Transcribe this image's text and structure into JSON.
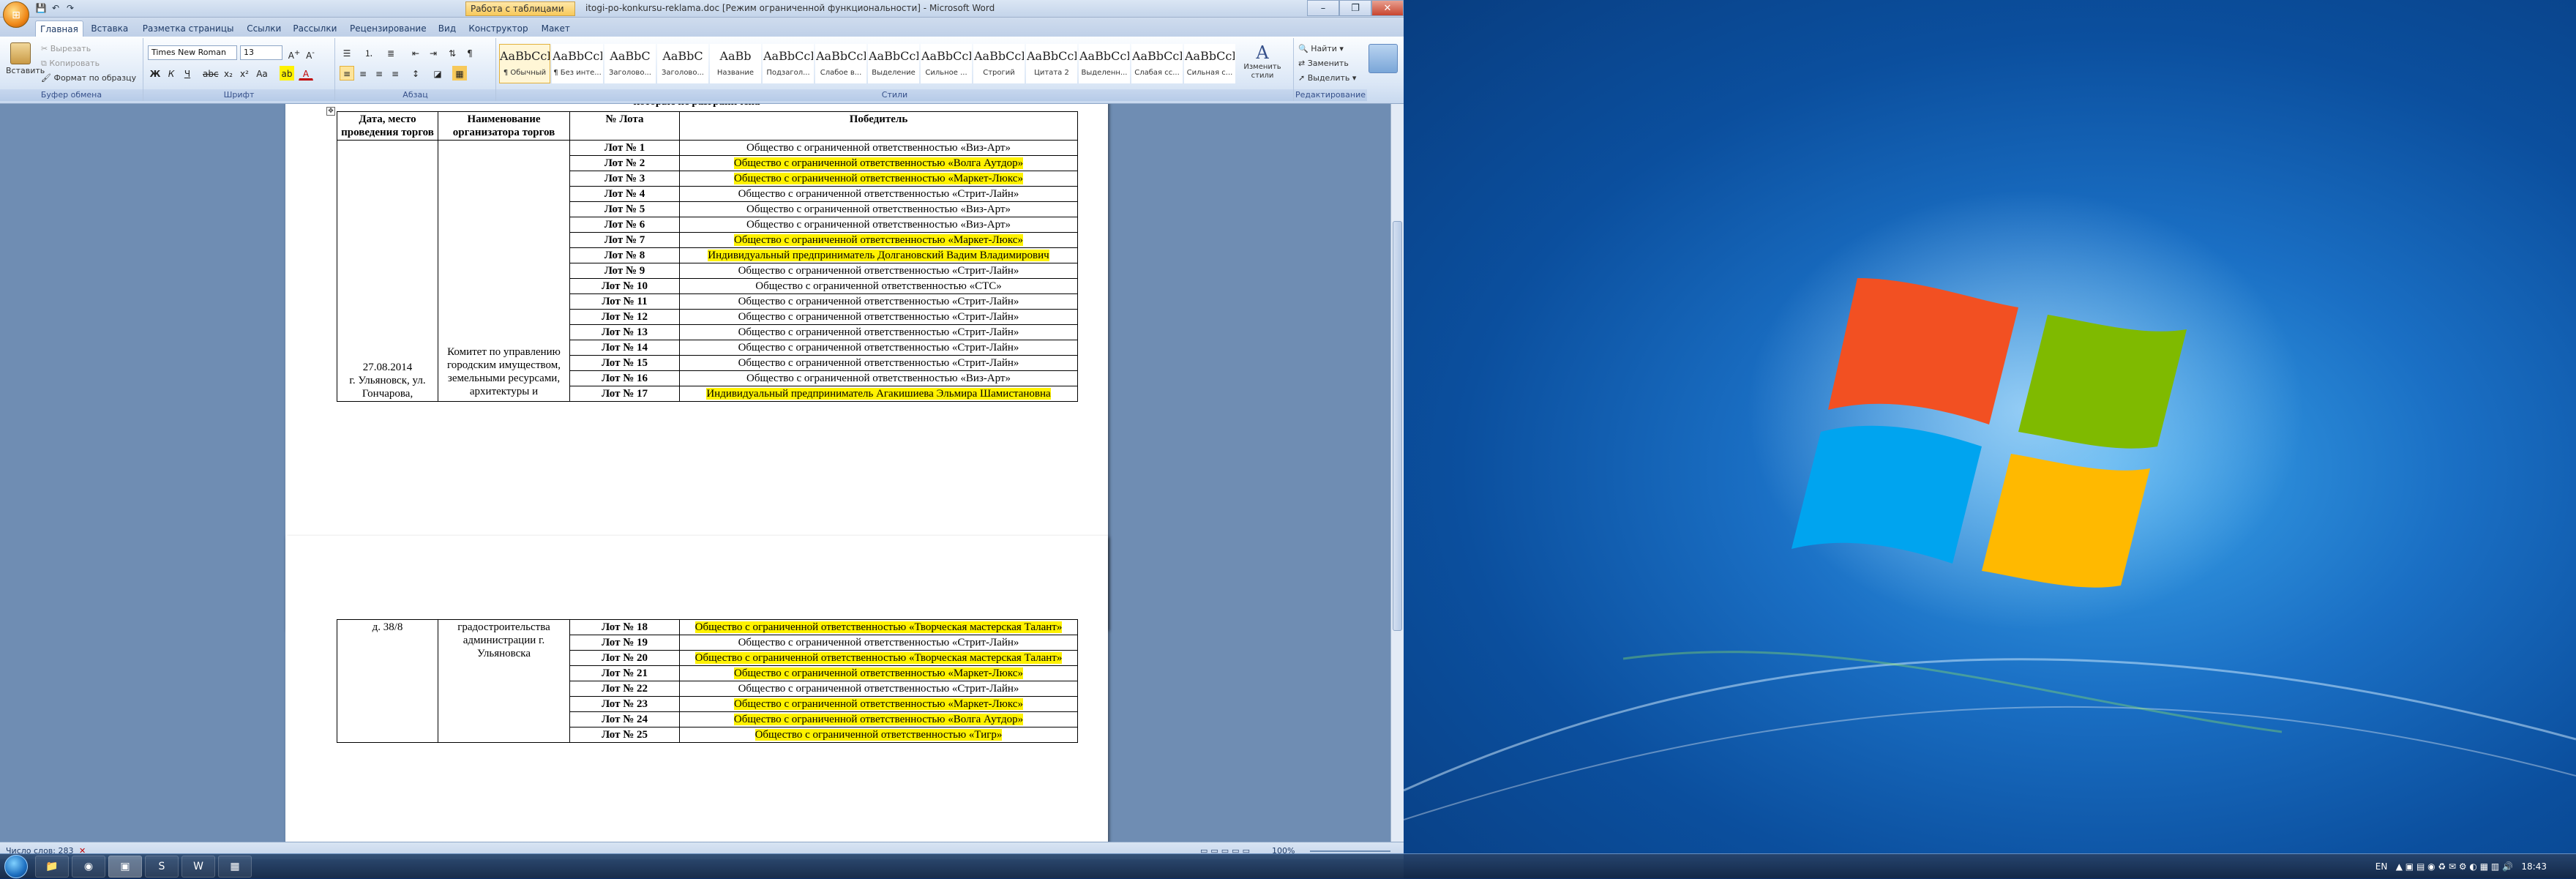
{
  "window": {
    "context_tab": "Работа с таблицами",
    "title": "itogi-po-konkursu-reklama.doc [Режим ограниченной функциональности] - Microsoft Word",
    "qat": [
      "save-icon",
      "undo-icon",
      "redo-icon"
    ]
  },
  "ribbon_tabs": [
    "Главная",
    "Вставка",
    "Разметка страницы",
    "Ссылки",
    "Рассылки",
    "Рецензирование",
    "Вид",
    "Конструктор",
    "Макет"
  ],
  "active_tab": "Главная",
  "clipboard": {
    "paste": "Вставить",
    "cut": "Вырезать",
    "copy": "Копировать",
    "format_painter": "Формат по образцу",
    "label": "Буфер обмена"
  },
  "font_group": {
    "font_name": "Times New Roman",
    "font_size": "13",
    "label": "Шрифт"
  },
  "paragraph_group": {
    "label": "Абзац"
  },
  "styles": [
    {
      "sample": "AaBbCcDc",
      "name": "¶ Обычный",
      "selected": true
    },
    {
      "sample": "AaBbCcDc",
      "name": "¶ Без инте..."
    },
    {
      "sample": "AaBbC",
      "name": "Заголово..."
    },
    {
      "sample": "AaBbC",
      "name": "Заголово..."
    },
    {
      "sample": "AaBb",
      "name": "Название"
    },
    {
      "sample": "AaBbCcI",
      "name": "Подзагол..."
    },
    {
      "sample": "AaBbCcDc",
      "name": "Слабое в..."
    },
    {
      "sample": "AaBbCcDc",
      "name": "Выделение"
    },
    {
      "sample": "AaBbCcDc",
      "name": "Сильное ..."
    },
    {
      "sample": "AaBbCcDc",
      "name": "Строгий"
    },
    {
      "sample": "AaBbCcDc",
      "name": "Цитата 2"
    },
    {
      "sample": "AaBbCcDc",
      "name": "Выделенн..."
    },
    {
      "sample": "AaBbCcDc",
      "name": "Слабая сс..."
    },
    {
      "sample": "AaBbCcDc",
      "name": "Сильная с..."
    }
  ],
  "styles_label": "Стили",
  "change_styles": "Изменить стили",
  "editing": {
    "find": "Найти",
    "replace": "Заменить",
    "select": "Выделить",
    "label": "Редактирование"
  },
  "page1_cut_text": "которые не разграничена",
  "table_headers": {
    "date": "Дата, место проведения торгов",
    "org": "Наименование организатора торгов",
    "lot": "№ Лота",
    "winner": "Победитель"
  },
  "page1": {
    "date_place": "27.08.2014\nг. Ульяновск, ул. Гончарова,",
    "organizer": "Комитет по управлению городским имуществом, земельными ресурсами, архитектуры и",
    "rows": [
      {
        "lot": "Лот № 1",
        "winner": "Общество с ограниченной ответственностью «Виз-Арт»",
        "hl": false
      },
      {
        "lot": "Лот № 2",
        "winner": "Общество с ограниченной ответственностью «Волга Аутдор»",
        "hl": true
      },
      {
        "lot": "Лот № 3",
        "winner": "Общество с ограниченной ответственностью «Маркет-Люкс»",
        "hl": true
      },
      {
        "lot": "Лот № 4",
        "winner": "Общество с ограниченной ответственностью «Стрит-Лайн»",
        "hl": false
      },
      {
        "lot": "Лот № 5",
        "winner": "Общество с ограниченной ответственностью «Виз-Арт»",
        "hl": false
      },
      {
        "lot": "Лот № 6",
        "winner": "Общество с ограниченной ответственностью «Виз-Арт»",
        "hl": false
      },
      {
        "lot": "Лот № 7",
        "winner": "Общество с ограниченной ответственностью «Маркет-Люкс»",
        "hl": true
      },
      {
        "lot": "Лот № 8",
        "winner": "Индивидуальный предприниматель Долгановский Вадим Владимирович",
        "hl": true
      },
      {
        "lot": "Лот № 9",
        "winner": "Общество с ограниченной ответственностью «Стрит-Лайн»",
        "hl": false
      },
      {
        "lot": "Лот № 10",
        "winner": "Общество с ограниченной ответственностью «СТС»",
        "hl": false
      },
      {
        "lot": "Лот № 11",
        "winner": "Общество с ограниченной ответственностью «Стрит-Лайн»",
        "hl": false
      },
      {
        "lot": "Лот № 12",
        "winner": "Общество с ограниченной ответственностью «Стрит-Лайн»",
        "hl": false
      },
      {
        "lot": "Лот № 13",
        "winner": "Общество с ограниченной ответственностью «Стрит-Лайн»",
        "hl": false
      },
      {
        "lot": "Лот № 14",
        "winner": "Общество с ограниченной ответственностью «Стрит-Лайн»",
        "hl": false
      },
      {
        "lot": "Лот № 15",
        "winner": "Общество с ограниченной ответственностью «Стрит-Лайн»",
        "hl": false
      },
      {
        "lot": "Лот № 16",
        "winner": "Общество с ограниченной ответственностью «Виз-Арт»",
        "hl": false
      },
      {
        "lot": "Лот № 17",
        "winner": "Индивидуальный предприниматель Агакишиева Эльмира Шамистановна",
        "hl": true
      }
    ]
  },
  "page2": {
    "date_place": "д. 38/8",
    "organizer": "градостроительства администрации г. Ульяновска",
    "rows": [
      {
        "lot": "Лот № 18",
        "winner": "Общество с ограниченной ответственностью «Творческая мастерская Талант»",
        "hl": true
      },
      {
        "lot": "Лот № 19",
        "winner": "Общество с ограниченной ответственностью «Стрит-Лайн»",
        "hl": false
      },
      {
        "lot": "Лот № 20",
        "winner": "Общество с ограниченной ответственностью «Творческая мастерская Талант»",
        "hl": true
      },
      {
        "lot": "Лот № 21",
        "winner": "Общество с ограниченной ответственностью «Маркет-Люкс»",
        "hl": true
      },
      {
        "lot": "Лот № 22",
        "winner": "Общество с ограниченной ответственностью «Стрит-Лайн»",
        "hl": false
      },
      {
        "lot": "Лот № 23",
        "winner": "Общество с ограниченной ответственностью «Маркет-Люкс»",
        "hl": true
      },
      {
        "lot": "Лот № 24",
        "winner": "Общество с ограниченной ответственностью «Волга Аутдор»",
        "hl": true
      },
      {
        "lot": "Лот № 25",
        "winner": "Общество с ограниченной ответственностью «Тигр»",
        "hl": true
      }
    ]
  },
  "status": {
    "word_count": "Число слов: 283",
    "zoom": "100%"
  },
  "taskbar": {
    "apps": [
      "explorer-icon",
      "chrome-icon",
      "word-window",
      "skype-icon",
      "word-icon",
      "app-icon"
    ],
    "lang": "EN",
    "clock": "18:43"
  },
  "colors": {
    "highlight": "#fff200",
    "ribbon_bg": "#dbe7f6",
    "desktop_bg": "#1a6fc4"
  }
}
